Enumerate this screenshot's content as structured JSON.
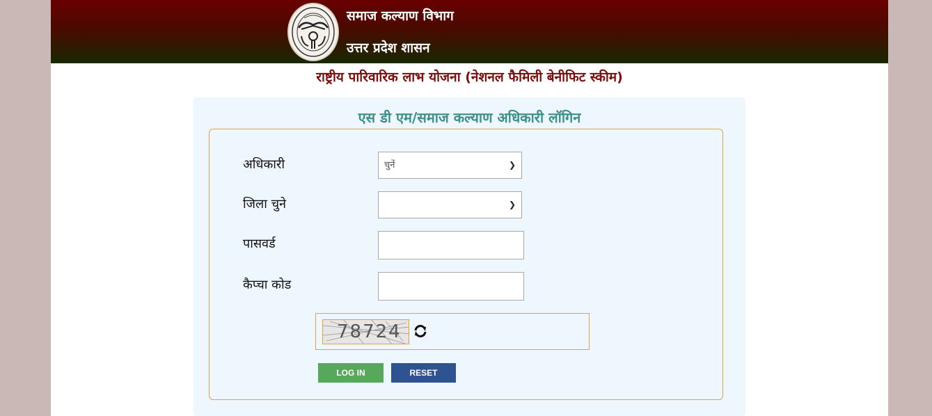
{
  "header": {
    "department": "समाज कल्याण विभाग",
    "state": "उत्तर प्रदेश शासन",
    "emblem_icon": "up-government-emblem-icon"
  },
  "scheme_title": "राष्ट्रीय पारिवारिक लाभ योजना (नेशनल फैमिली बेनीफिट स्कीम)",
  "login": {
    "title": "एस डी एम/समाज कल्याण अधिकारी लॉगिन",
    "officer_label": "अधिकारी",
    "officer_selected": "चुनें",
    "district_label": "जिला चुने",
    "district_selected": "",
    "password_label": "पासवर्ड",
    "password_value": "",
    "captcha_label": "कैप्चा कोड",
    "captcha_value": "",
    "captcha_image_text": "78724",
    "refresh_icon": "refresh-icon",
    "login_button": "LOG IN",
    "reset_button": "RESET"
  },
  "colors": {
    "header_top": "#6a0000",
    "header_bottom": "#182800",
    "scheme_title": "#7a0d0d",
    "login_title": "#3c8f8a",
    "border_accent": "#e5a23a",
    "login_button": "#58a85c",
    "reset_button": "#2f5291"
  }
}
